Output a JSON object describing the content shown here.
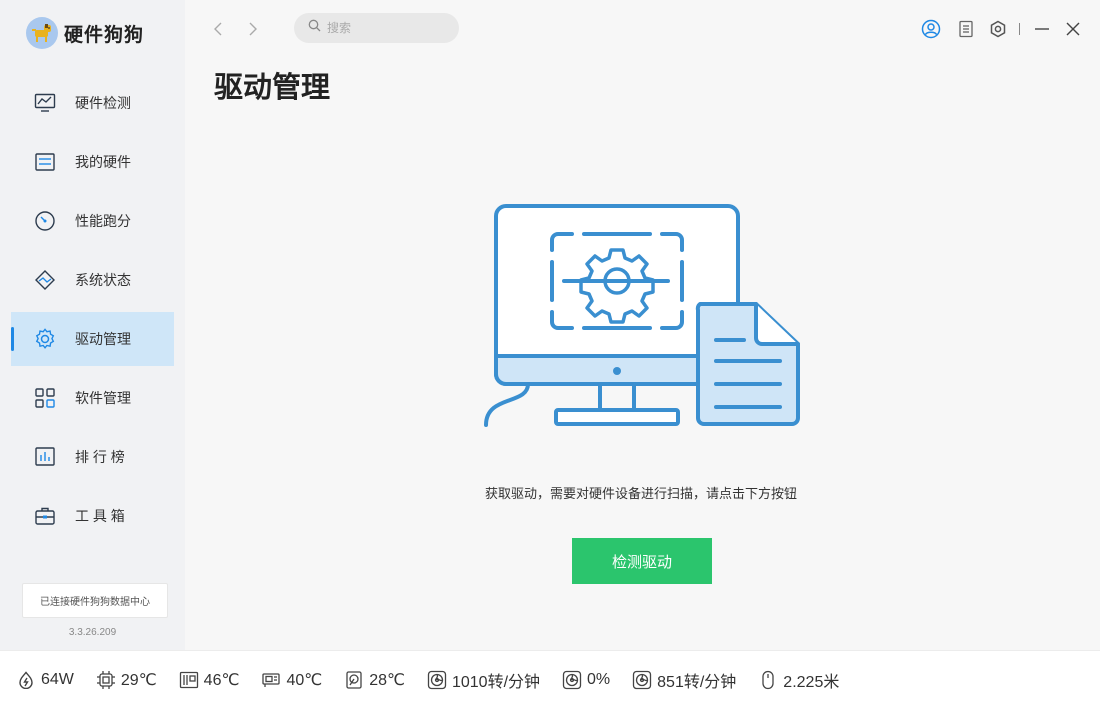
{
  "app": {
    "name": "硬件狗狗"
  },
  "sidebar": {
    "items": [
      {
        "label": "硬件检测",
        "icon": "monitor-chart-icon",
        "active": false
      },
      {
        "label": "我的硬件",
        "icon": "chip-board-icon",
        "active": false
      },
      {
        "label": "性能跑分",
        "icon": "speedometer-icon",
        "active": false
      },
      {
        "label": "系统状态",
        "icon": "pulse-icon",
        "active": false
      },
      {
        "label": "驱动管理",
        "icon": "gear-icon",
        "active": true
      },
      {
        "label": "软件管理",
        "icon": "apps-grid-icon",
        "active": false
      },
      {
        "label": "排 行 榜",
        "icon": "bar-chart-icon",
        "active": false
      },
      {
        "label": "工 具 箱",
        "icon": "toolbox-icon",
        "active": false
      }
    ],
    "status": "已连接硬件狗狗数据中心",
    "version": "3.3.26.209"
  },
  "topbar": {
    "search_placeholder": "搜索"
  },
  "main": {
    "title": "驱动管理",
    "hint": "获取驱动，需要对硬件设备进行扫描，请点击下方按钮",
    "button": "检测驱动"
  },
  "bottom": {
    "metrics": [
      {
        "icon": "power-icon",
        "value": "64W"
      },
      {
        "icon": "cpu-icon",
        "value": "29℃"
      },
      {
        "icon": "motherboard-icon",
        "value": "46℃"
      },
      {
        "icon": "gpu-icon",
        "value": "40℃"
      },
      {
        "icon": "disk-icon",
        "value": "28℃"
      },
      {
        "icon": "fan-icon",
        "value": "1010转/分钟"
      },
      {
        "icon": "fan-icon",
        "value": "0%"
      },
      {
        "icon": "fan-icon",
        "value": "851转/分钟"
      },
      {
        "icon": "mouse-icon",
        "value": "2.225米"
      }
    ]
  },
  "colors": {
    "accent": "#1e88e5",
    "active_bg": "#cfe6f8",
    "button": "#2bc56d",
    "illustration": "#3a8fd0"
  }
}
